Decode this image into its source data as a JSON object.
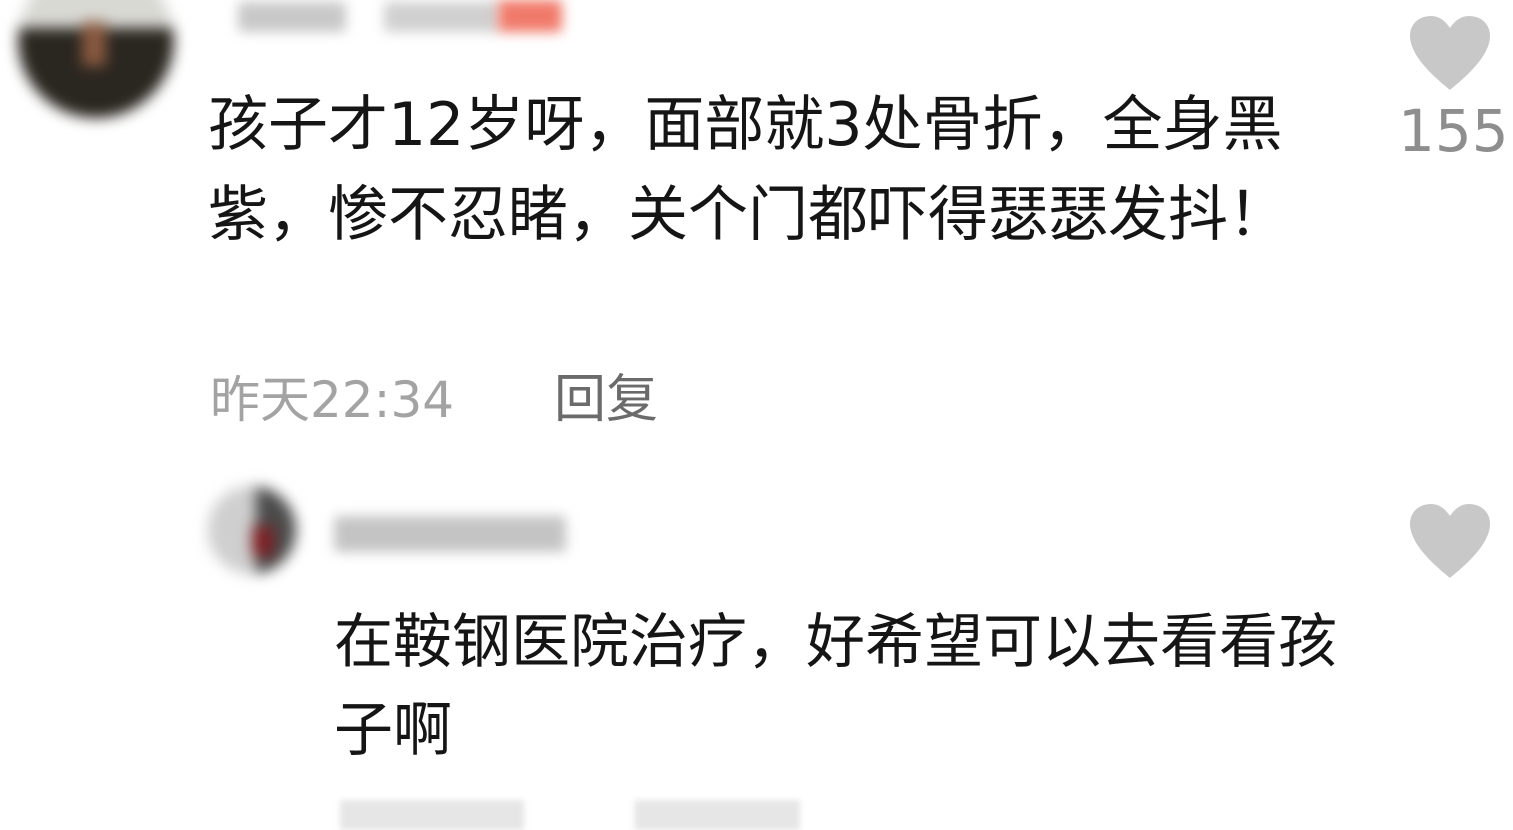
{
  "comment": {
    "text": "孩子才12岁呀，面部就3处骨折，全身黑紫，惨不忍睹，关个门都吓得瑟瑟发抖！",
    "time": "昨天22:34",
    "reply_label": "回复",
    "like_count": "155",
    "like_icon": "heart-icon"
  },
  "reply": {
    "text": "在鞍钢医院治疗，好希望可以去看看孩子啊",
    "like_icon": "heart-icon"
  },
  "colors": {
    "text": "#151515",
    "meta": "#a3a3a3",
    "reply_link": "#6b6b6b",
    "heart": "#c8c8c8",
    "like_count": "#8e8e8e"
  }
}
